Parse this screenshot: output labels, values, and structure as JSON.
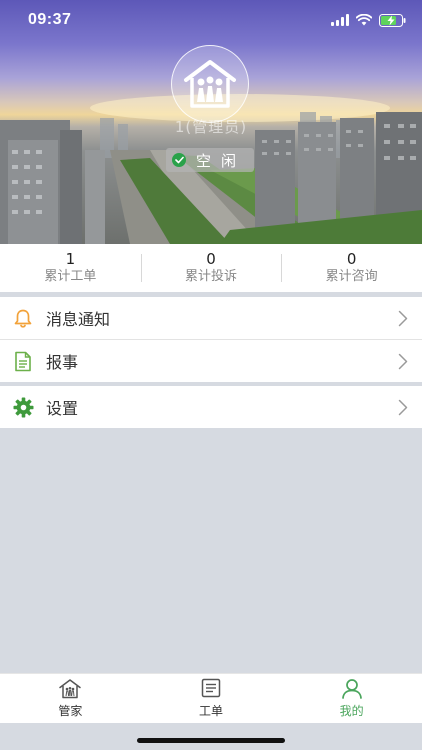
{
  "status_bar": {
    "time": "09:37"
  },
  "profile": {
    "name": "1(管理员)",
    "status": "空闲"
  },
  "stats": [
    {
      "value": "1",
      "label": "累计工单"
    },
    {
      "value": "0",
      "label": "累计投诉"
    },
    {
      "value": "0",
      "label": "累计咨询"
    }
  ],
  "menu": {
    "notifications": "消息通知",
    "report": "报事",
    "settings": "设置"
  },
  "bottom_nav": [
    {
      "label": "管家",
      "icon": "house-icon"
    },
    {
      "label": "工单",
      "icon": "document-list-icon"
    },
    {
      "label": "我的",
      "icon": "person-icon"
    }
  ],
  "colors": {
    "accent_green": "#4aa55c",
    "bell_orange": "#f2a23a",
    "background": "#d6dae1"
  }
}
